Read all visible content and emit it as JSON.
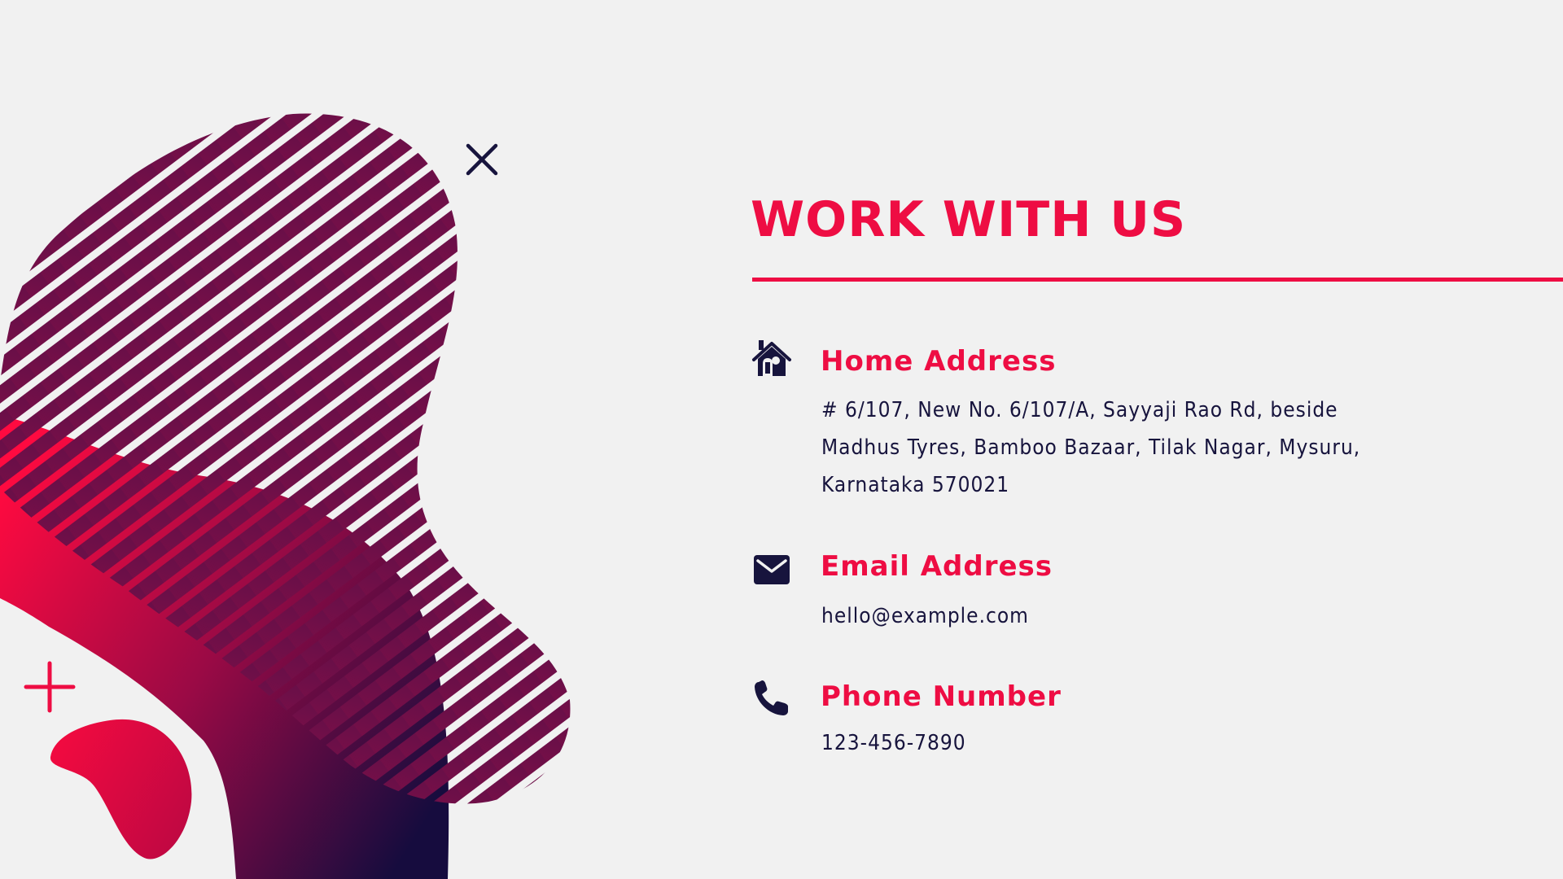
{
  "colors": {
    "background": "#f1f1f1",
    "accent": "#ee0d43",
    "navy": "#17143d"
  },
  "decorations": {
    "cross_icon": "x-mark",
    "plus_icon": "plus-sign"
  },
  "heading": {
    "title": "WORK WITH US"
  },
  "contacts": {
    "home": {
      "icon": "home-icon",
      "label": "Home Address",
      "value": "# 6/107, New No. 6/107/A, Sayyaji Rao Rd, beside Madhus Tyres, Bamboo Bazaar, Tilak Nagar, Mysuru, Karnataka 570021"
    },
    "email": {
      "icon": "envelope-icon",
      "label": "Email Address",
      "value": "hello@example.com"
    },
    "phone": {
      "icon": "phone-icon",
      "label": "Phone Number",
      "value": "123-456-7890"
    }
  }
}
